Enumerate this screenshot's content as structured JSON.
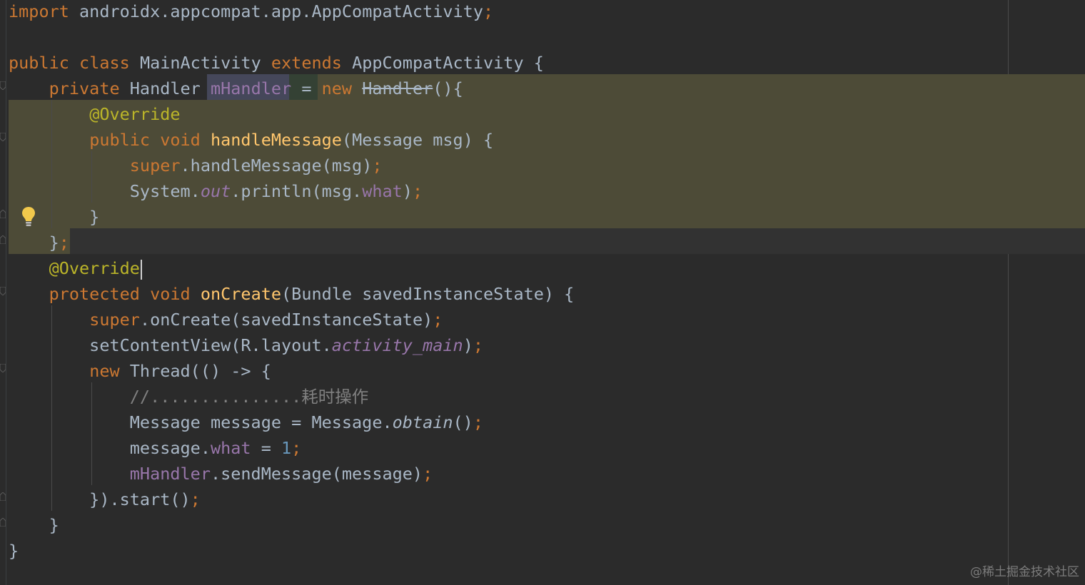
{
  "editor": {
    "lines": [
      {
        "tokens": [
          {
            "t": "import",
            "c": "kw"
          },
          {
            "t": " androidx.appcompat.app.AppCompatActivity"
          },
          {
            "t": ";",
            "c": "semi"
          }
        ]
      },
      {
        "tokens": []
      },
      {
        "tokens": [
          {
            "t": "public",
            "c": "kw"
          },
          {
            "t": " "
          },
          {
            "t": "class",
            "c": "kw"
          },
          {
            "t": " MainActivity "
          },
          {
            "t": "extends",
            "c": "kw"
          },
          {
            "t": " AppCompatActivity {"
          }
        ]
      },
      {
        "tokens": [
          {
            "t": "    "
          },
          {
            "t": "private",
            "c": "kw"
          },
          {
            "t": " Handler "
          },
          {
            "t": "mHandler",
            "c": "fld"
          },
          {
            "t": " = "
          },
          {
            "t": "new",
            "c": "kw"
          },
          {
            "t": " "
          },
          {
            "t": "Handler",
            "c": "strike"
          },
          {
            "t": "(){"
          }
        ]
      },
      {
        "tokens": [
          {
            "t": "        "
          },
          {
            "t": "@Override",
            "c": "ann"
          }
        ]
      },
      {
        "tokens": [
          {
            "t": "        "
          },
          {
            "t": "public",
            "c": "kw"
          },
          {
            "t": " "
          },
          {
            "t": "void",
            "c": "kw"
          },
          {
            "t": " "
          },
          {
            "t": "handleMessage",
            "c": "fn"
          },
          {
            "t": "(Message msg) {"
          }
        ]
      },
      {
        "tokens": [
          {
            "t": "            "
          },
          {
            "t": "super",
            "c": "kw"
          },
          {
            "t": ".handleMessage(msg)"
          },
          {
            "t": ";",
            "c": "semi"
          }
        ]
      },
      {
        "tokens": [
          {
            "t": "            System."
          },
          {
            "t": "out",
            "c": "sfld"
          },
          {
            "t": ".println(msg."
          },
          {
            "t": "what",
            "c": "fld"
          },
          {
            "t": ")"
          },
          {
            "t": ";",
            "c": "semi"
          }
        ]
      },
      {
        "tokens": [
          {
            "t": "        }"
          }
        ]
      },
      {
        "tokens": [
          {
            "t": "    }"
          },
          {
            "t": ";",
            "c": "semi"
          }
        ]
      },
      {
        "tokens": [
          {
            "t": "    "
          },
          {
            "t": "@Override",
            "c": "ann"
          }
        ]
      },
      {
        "tokens": [
          {
            "t": "    "
          },
          {
            "t": "protected",
            "c": "kw"
          },
          {
            "t": " "
          },
          {
            "t": "void",
            "c": "kw"
          },
          {
            "t": " "
          },
          {
            "t": "onCreate",
            "c": "fn"
          },
          {
            "t": "(Bundle savedInstanceState) {"
          }
        ]
      },
      {
        "tokens": [
          {
            "t": "        "
          },
          {
            "t": "super",
            "c": "kw"
          },
          {
            "t": ".onCreate(savedInstanceState)"
          },
          {
            "t": ";",
            "c": "semi"
          }
        ]
      },
      {
        "tokens": [
          {
            "t": "        setContentView(R.layout."
          },
          {
            "t": "activity_main",
            "c": "sfld"
          },
          {
            "t": ")"
          },
          {
            "t": ";",
            "c": "semi"
          }
        ]
      },
      {
        "tokens": [
          {
            "t": "        "
          },
          {
            "t": "new",
            "c": "kw"
          },
          {
            "t": " Thread(() -> {"
          }
        ]
      },
      {
        "tokens": [
          {
            "t": "            "
          },
          {
            "t": "//...............耗时操作",
            "c": "cmt"
          }
        ]
      },
      {
        "tokens": [
          {
            "t": "            Message message = Message."
          },
          {
            "t": "obtain",
            "c": "it"
          },
          {
            "t": "()"
          },
          {
            "t": ";",
            "c": "semi"
          }
        ]
      },
      {
        "tokens": [
          {
            "t": "            message."
          },
          {
            "t": "what",
            "c": "fld"
          },
          {
            "t": " = "
          },
          {
            "t": "1",
            "c": "num"
          },
          {
            "t": ";",
            "c": "semi"
          }
        ]
      },
      {
        "tokens": [
          {
            "t": "            "
          },
          {
            "t": "mHandler",
            "c": "fld"
          },
          {
            "t": ".sendMessage(message)"
          },
          {
            "t": ";",
            "c": "semi"
          }
        ]
      },
      {
        "tokens": [
          {
            "t": "        }).start()"
          },
          {
            "t": ";",
            "c": "semi"
          }
        ]
      },
      {
        "tokens": [
          {
            "t": "    }"
          }
        ]
      },
      {
        "tokens": [
          {
            "t": "}"
          }
        ]
      }
    ],
    "caret_line": 10,
    "bulb_icon": "lightbulb-icon"
  },
  "watermark": "@稀土掘金技术社区",
  "colors": {
    "background": "#2b2b2b",
    "keyword": "#cc7832",
    "annotation": "#bbb529",
    "function": "#ffc66d",
    "field": "#9876aa",
    "number": "#6897bb",
    "comment": "#808080",
    "highlight": "#4d4b37",
    "bulb": "#f2c94c"
  }
}
